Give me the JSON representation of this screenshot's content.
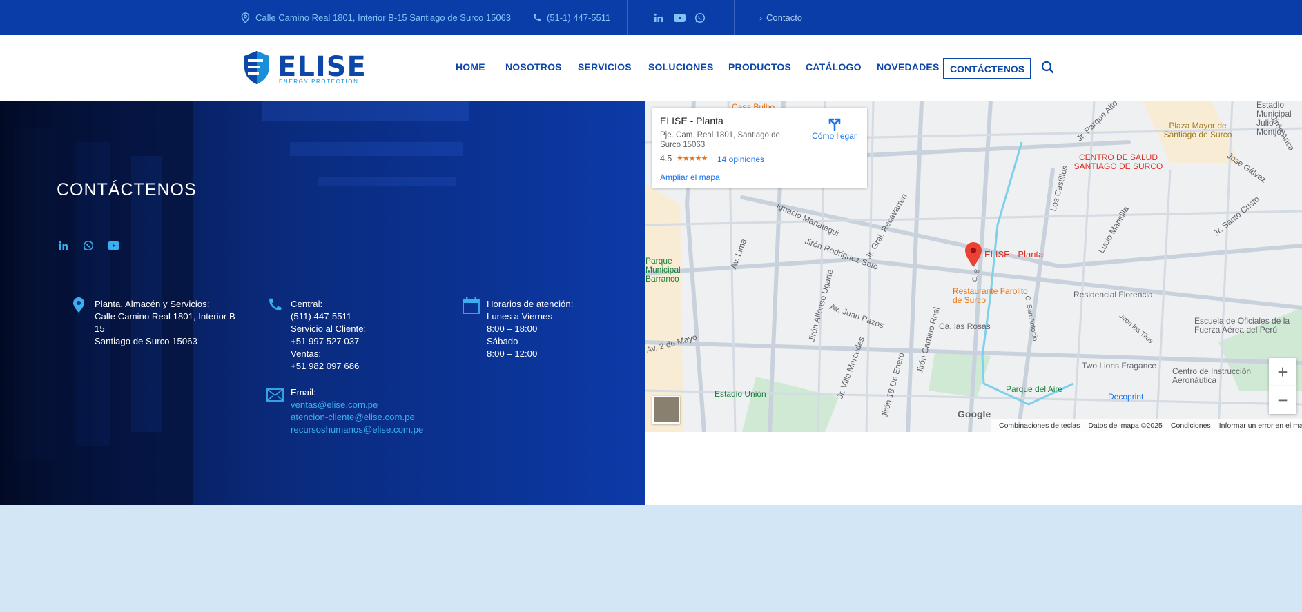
{
  "topbar": {
    "address": "Calle Camino Real 1801, Interior B-15 Santiago de Surco 15063",
    "phone": "(51-1) 447-5511",
    "contact": "Contacto",
    "social": [
      "linkedin-icon",
      "youtube-icon",
      "whatsapp-icon"
    ]
  },
  "brand": {
    "name": "ELISE",
    "tagline": "ENERGY PROTECTION"
  },
  "nav": {
    "items": [
      "HOME",
      "NOSOTROS",
      "SERVICIOS",
      "SOLUCIONES",
      "PRODUCTOS",
      "CATÁLOGO",
      "NOVEDADES"
    ],
    "cta": "CONTÁCTENOS"
  },
  "contact": {
    "title": "CONTÁCTENOS",
    "social": [
      "linkedin-icon",
      "whatsapp-icon",
      "youtube-icon"
    ],
    "location": {
      "heading": "Planta, Almacén y Servicios:",
      "line1": "Calle Camino Real 1801, Interior B-",
      "line2": "15",
      "line3": "Santiago de Surco 15063"
    },
    "phones": {
      "central_label": "Central:",
      "central": "(511) 447-5511",
      "service_label": "Servicio al Cliente:",
      "service": "+51 997 527 037",
      "sales_label": "Ventas:",
      "sales": "+51 982 097 686"
    },
    "email": {
      "label": "Email:",
      "addresses": [
        "ventas@elise.com.pe",
        "atencion-cliente@elise.com.pe",
        "recursoshumanos@elise.com.pe"
      ]
    },
    "hours": {
      "heading": "Horarios de atención:",
      "weekday_label": "Lunes a Viernes",
      "weekday_hours": "8:00 – 18:00",
      "saturday_label": "Sábado",
      "saturday_hours": "8:00 – 12:00"
    }
  },
  "map": {
    "card": {
      "name": "ELISE - Planta",
      "address": "Pje. Cam. Real 1801, Santiago de Surco 15063",
      "rating": "4.5",
      "stars": "★★★★★",
      "reviews": "14 opiniones",
      "expand": "Ampliar el mapa",
      "directions": "Cómo llegar"
    },
    "pin_label": "ELISE - Planta",
    "places": [
      "Casa Bulbo",
      "Plaza Mayor de Santiago de Surco",
      "CENTRO DE SALUD SANTIAGO DE SURCO",
      "Restaurante Farolito de Surco",
      "Residencial Florencia",
      "Escuela de Oficiales de la Fuerza Aérea del Perú",
      "Two Lions Fragance",
      "Parque del Aire",
      "Decoprint",
      "Estadio Unión",
      "Centro de Instrucción Aeronáutica",
      "Parque Municipal Barranco",
      "Estadio Municipal Julio Montjoy"
    ],
    "streets": [
      "Ignacio Mariategui",
      "Jirón Rodriguez Soto",
      "Jr. Gral. Recavarren",
      "Av. Lima",
      "Jirón Alfonso Ugarte",
      "Av. Juan Pazos",
      "Jirón Camino Real",
      "Ca. las Rosas",
      "Jr. Villa Mercedes",
      "Jirón 18 De Enero",
      "Los Castillos",
      "Lucio Mansilla",
      "Jr. Santo Cristo",
      "José Gálvez",
      "Jirón Arica",
      "Jr. Parque Alto",
      "Jirón los Tilos",
      "Av. 2 de Mayo",
      "C. San Antonio",
      "C. 8"
    ],
    "google": "Google",
    "footer": [
      "Combinaciones de teclas",
      "Datos del mapa ©2025",
      "Condiciones",
      "Informar un error en el mapa"
    ],
    "zoom_in": "+",
    "zoom_out": "−"
  }
}
